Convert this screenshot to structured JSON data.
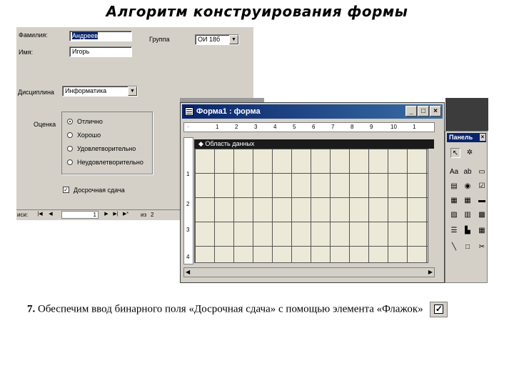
{
  "slide": {
    "title": "Алгоритм конструирования формы"
  },
  "form_view": {
    "labels": {
      "surname": "Фамилия:",
      "name": "Имя:",
      "group": "Группа",
      "discipline": "Дисциплина",
      "grade": "Оценка"
    },
    "values": {
      "surname": "Андреев",
      "name": "Игорь",
      "group": "ОИ 18б",
      "discipline": "Информатика"
    },
    "grade_options": [
      {
        "label": "Отлично",
        "selected": true
      },
      {
        "label": "Хорошо",
        "selected": false
      },
      {
        "label": "Удовлетворительно",
        "selected": false
      },
      {
        "label": "Неудовлетворительно",
        "selected": false
      }
    ],
    "early_checkbox": {
      "label": "Досрочная сдача",
      "checked": true
    },
    "navigation": {
      "record_label": "иси:",
      "current": "1",
      "of_label": "из",
      "total": "2"
    }
  },
  "design_window": {
    "title": "Форма1 : форма",
    "section_label": "◆ Область данных",
    "ruler_h_ticks": [
      "1",
      "2",
      "3",
      "4",
      "5",
      "6",
      "7",
      "8",
      "9",
      "10",
      "1"
    ],
    "ruler_v_ticks": [
      "1",
      "2",
      "3",
      "4"
    ],
    "buttons": {
      "minimize": "_",
      "maximize": "□",
      "close": "×"
    }
  },
  "tool_panel": {
    "title": "Панель",
    "close": "×",
    "tools": [
      "pointer",
      "magic-wand",
      "label-Aa",
      "textbox-ab",
      "toggle",
      "option",
      "checkbox",
      "combo",
      "list",
      "command",
      "image",
      "frame",
      "bound-frame",
      "page-break",
      "tab",
      "subform",
      "line",
      "rectangle",
      "more"
    ]
  },
  "caption": {
    "number": "7.",
    "text": "Обеспечим ввод бинарного поля «Досрочная сдача» с помощью элемента «Флажок»"
  }
}
